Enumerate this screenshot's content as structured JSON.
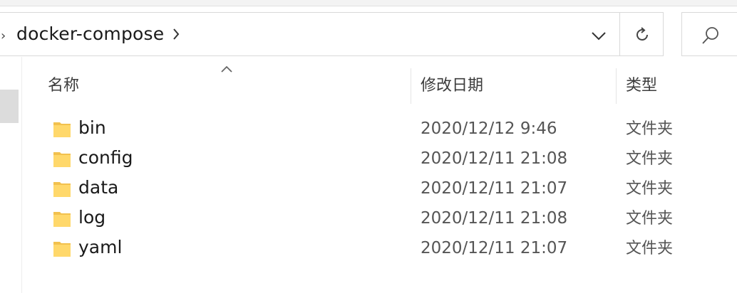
{
  "address_bar": {
    "path_segment": "docker-compose"
  },
  "columns": {
    "name": "名称",
    "date_modified": "修改日期",
    "type": "类型"
  },
  "files": [
    {
      "name": "bin",
      "date": "2020/12/12 9:46",
      "type": "文件夹"
    },
    {
      "name": "config",
      "date": "2020/12/11 21:08",
      "type": "文件夹"
    },
    {
      "name": "data",
      "date": "2020/12/11 21:07",
      "type": "文件夹"
    },
    {
      "name": "log",
      "date": "2020/12/11 21:08",
      "type": "文件夹"
    },
    {
      "name": "yaml",
      "date": "2020/12/11 21:07",
      "type": "文件夹"
    }
  ],
  "icons": {
    "folder": "folder-icon",
    "refresh": "refresh-icon",
    "search": "search-icon",
    "sort": "sort-ascending-icon",
    "dropdown": "chevron-down-icon",
    "breadcrumb_separator": "chevron-right-icon"
  },
  "colors": {
    "folder_fill": "#ffd86b",
    "folder_shade": "#f2c14e",
    "border": "#d9d9d9",
    "selection": "#dcdcdc"
  }
}
